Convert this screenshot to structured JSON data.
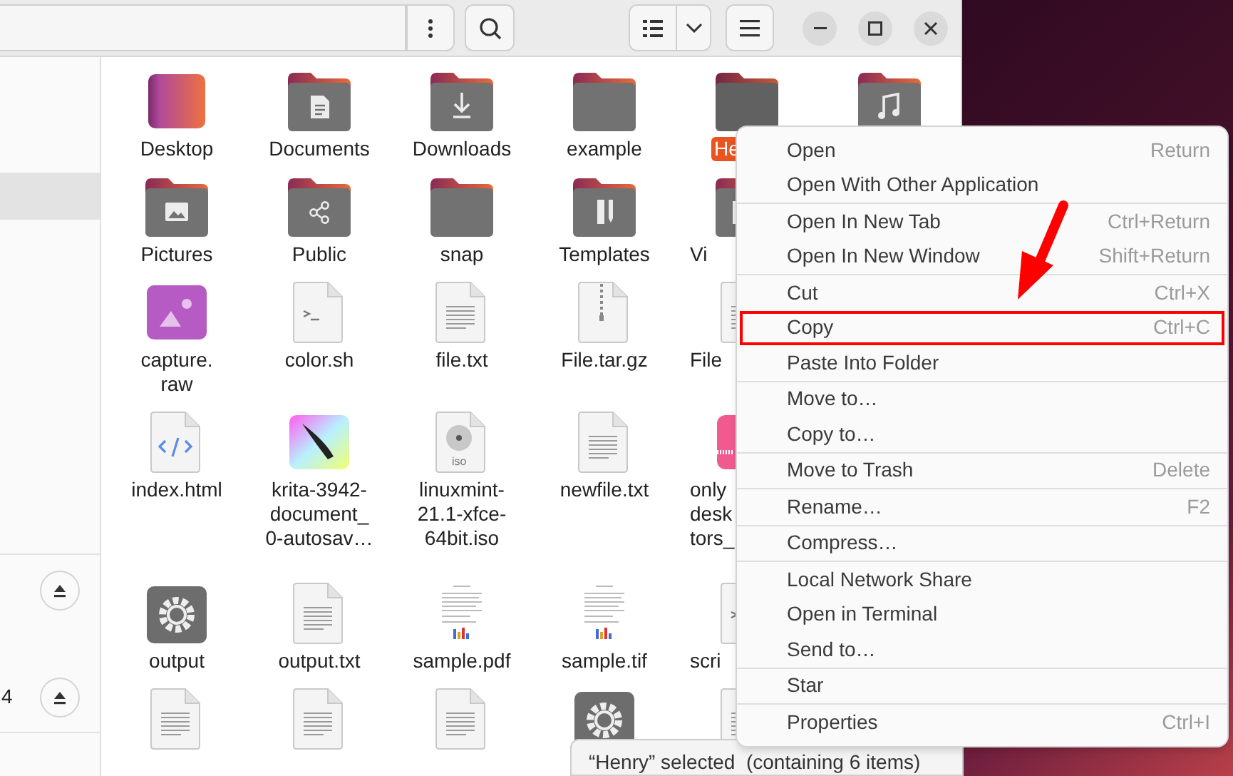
{
  "sidebar": {
    "items": [
      {
        "selected": true
      },
      {
        "selected": false,
        "eject": true
      },
      {
        "selected": false,
        "label": "4",
        "eject": true
      }
    ]
  },
  "files": {
    "rows": [
      [
        {
          "label": "Desktop",
          "kind": "desktop",
          "selected": false
        },
        {
          "label": "Documents",
          "kind": "documents",
          "selected": false
        },
        {
          "label": "Downloads",
          "kind": "downloads",
          "selected": false
        },
        {
          "label": "example",
          "kind": "folder",
          "selected": false
        },
        {
          "label": "He",
          "kind": "folder",
          "selected": true
        },
        {
          "kind": "music",
          "selected": false
        }
      ],
      [
        {
          "label": "Pictures",
          "kind": "pictures",
          "selected": false
        },
        {
          "label": "Public",
          "kind": "public",
          "selected": false
        },
        {
          "label": "snap",
          "kind": "folder",
          "selected": false
        },
        {
          "label": "Templates",
          "kind": "templates",
          "selected": false
        },
        {
          "label": "Vi",
          "kind": "videos",
          "selected": false
        }
      ],
      [
        {
          "label": "capture.\nraw",
          "kind": "image",
          "selected": false
        },
        {
          "label": "color.sh",
          "kind": "script",
          "selected": false
        },
        {
          "label": "file.txt",
          "kind": "text",
          "selected": false
        },
        {
          "label": "File.tar.gz",
          "kind": "archive",
          "selected": false
        },
        {
          "label": "File",
          "kind": "text",
          "selected": false
        }
      ],
      [
        {
          "label": "index.html",
          "kind": "code",
          "selected": false
        },
        {
          "label": "krita-3942-\ndocument_\n0-autosav…",
          "kind": "krita",
          "selected": false
        },
        {
          "label": "linuxmint-\n21.1-xfce-\n64bit.iso",
          "kind": "disc",
          "badge": "iso",
          "selected": false
        },
        {
          "label": "newfile.txt",
          "kind": "text",
          "selected": false
        },
        {
          "label": "only\ndesk\ntors_",
          "kind": "office",
          "selected": false
        }
      ],
      [
        {
          "label": "output",
          "kind": "executable",
          "selected": false
        },
        {
          "label": "output.txt",
          "kind": "text",
          "selected": false
        },
        {
          "label": "sample.pdf",
          "kind": "preview",
          "selected": false
        },
        {
          "label": "sample.tif",
          "kind": "preview",
          "selected": false
        },
        {
          "label": "scri",
          "kind": "script",
          "selected": false
        }
      ],
      [
        {
          "kind": "text",
          "selected": false
        },
        {
          "kind": "text",
          "selected": false
        },
        {
          "kind": "text",
          "selected": false
        },
        {
          "kind": "executable",
          "selected": false
        },
        {
          "kind": "text",
          "selected": false
        }
      ]
    ]
  },
  "status_bar": {
    "text": "“Henry” selected  (containing 6 items)"
  },
  "context_menu": {
    "groups": [
      [
        {
          "label": "Open",
          "shortcut": "Return",
          "highlighted": false
        },
        {
          "label": "Open With Other Application",
          "highlighted": false
        }
      ],
      [
        {
          "label": "Open In New Tab",
          "shortcut": "Ctrl+Return",
          "highlighted": false
        },
        {
          "label": "Open In New Window",
          "shortcut": "Shift+Return",
          "highlighted": false
        }
      ],
      [
        {
          "label": "Cut",
          "shortcut": "Ctrl+X",
          "highlighted": false
        },
        {
          "label": "Copy",
          "shortcut": "Ctrl+C",
          "highlighted": true
        },
        {
          "label": "Paste Into Folder",
          "highlighted": false
        }
      ],
      [
        {
          "label": "Move to…",
          "highlighted": false
        },
        {
          "label": "Copy to…",
          "highlighted": false
        }
      ],
      [
        {
          "label": "Move to Trash",
          "shortcut": "Delete",
          "highlighted": false
        }
      ],
      [
        {
          "label": "Rename…",
          "shortcut": "F2",
          "highlighted": false
        }
      ],
      [
        {
          "label": "Compress…",
          "highlighted": false
        }
      ],
      [
        {
          "label": "Local Network Share",
          "highlighted": false
        },
        {
          "label": "Open in Terminal",
          "highlighted": false
        },
        {
          "label": "Send to…",
          "highlighted": false
        }
      ],
      [
        {
          "label": "Star",
          "highlighted": false
        }
      ],
      [
        {
          "label": "Properties",
          "shortcut": "Ctrl+I",
          "highlighted": false
        }
      ]
    ]
  }
}
